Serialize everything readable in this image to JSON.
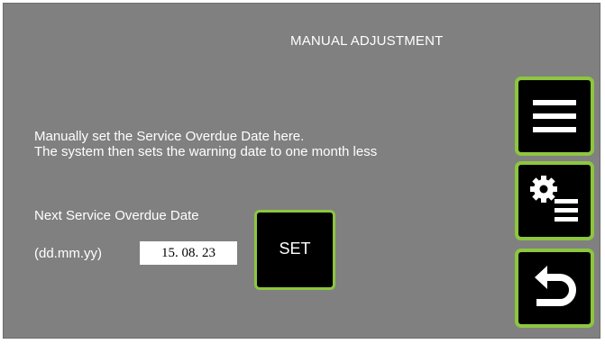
{
  "header": {
    "title": "MANUAL ADJUSTMENT"
  },
  "description": {
    "line1": "Manually set the Service Overdue Date here.",
    "line2": "The system then sets the warning date to one month less"
  },
  "service_date": {
    "label": "Next Service Overdue Date",
    "format_label": "(dd.mm.yy)",
    "value": "15. 08. 23"
  },
  "set_button": {
    "label": "SET"
  },
  "side_buttons": [
    {
      "icon": "menu-icon"
    },
    {
      "icon": "settings-list-icon"
    },
    {
      "icon": "back-arrow-icon"
    }
  ],
  "colors": {
    "background": "#808080",
    "button_fill": "#000000",
    "button_border": "#8dc63f",
    "text": "#ffffff"
  }
}
